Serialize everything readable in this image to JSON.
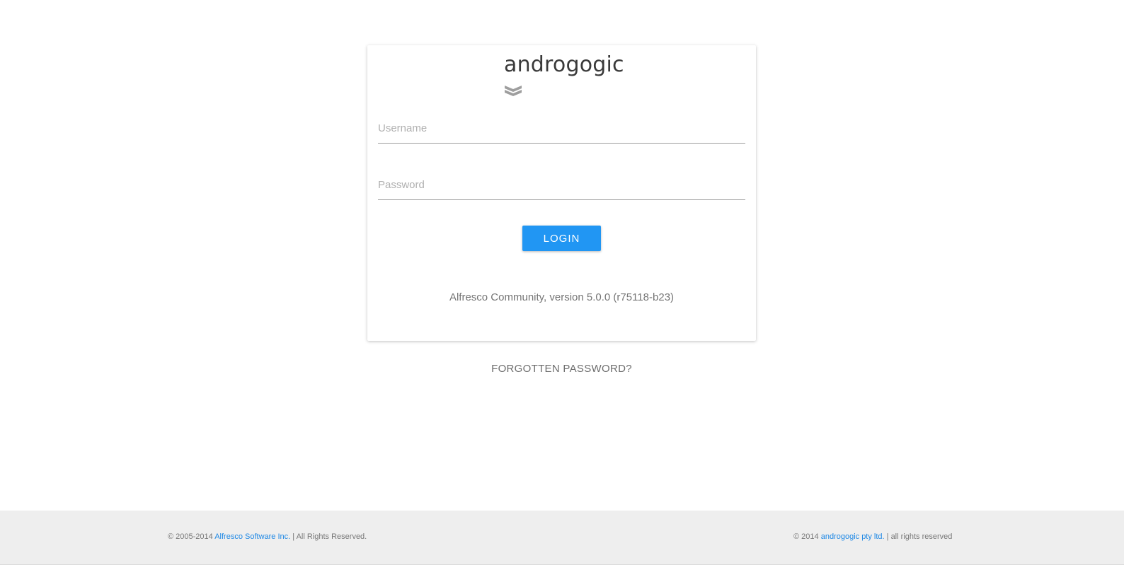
{
  "logo": {
    "text": "androgogic",
    "mark_icon": "double-chevron-down-icon",
    "mark_color": "#9e9e9e"
  },
  "login_form": {
    "username": {
      "value": "",
      "placeholder": "Username"
    },
    "password": {
      "value": "",
      "placeholder": "Password"
    },
    "login_label": "LOGIN",
    "version_text": "Alfresco Community, version 5.0.0 (r75118-b23)"
  },
  "forgot_password_label": "FORGOTTEN PASSWORD?",
  "footer": {
    "left": {
      "prefix": "© 2005-2014 ",
      "link": "Alfresco Software Inc.",
      "suffix": " | All Rights Reserved."
    },
    "right": {
      "prefix": "© 2014 ",
      "link": "androgogic pty ltd.",
      "suffix": " | all rights reserved"
    }
  },
  "colors": {
    "accent": "#2196f3",
    "link": "#1e88e5",
    "footer_bg": "#eeeeee"
  }
}
